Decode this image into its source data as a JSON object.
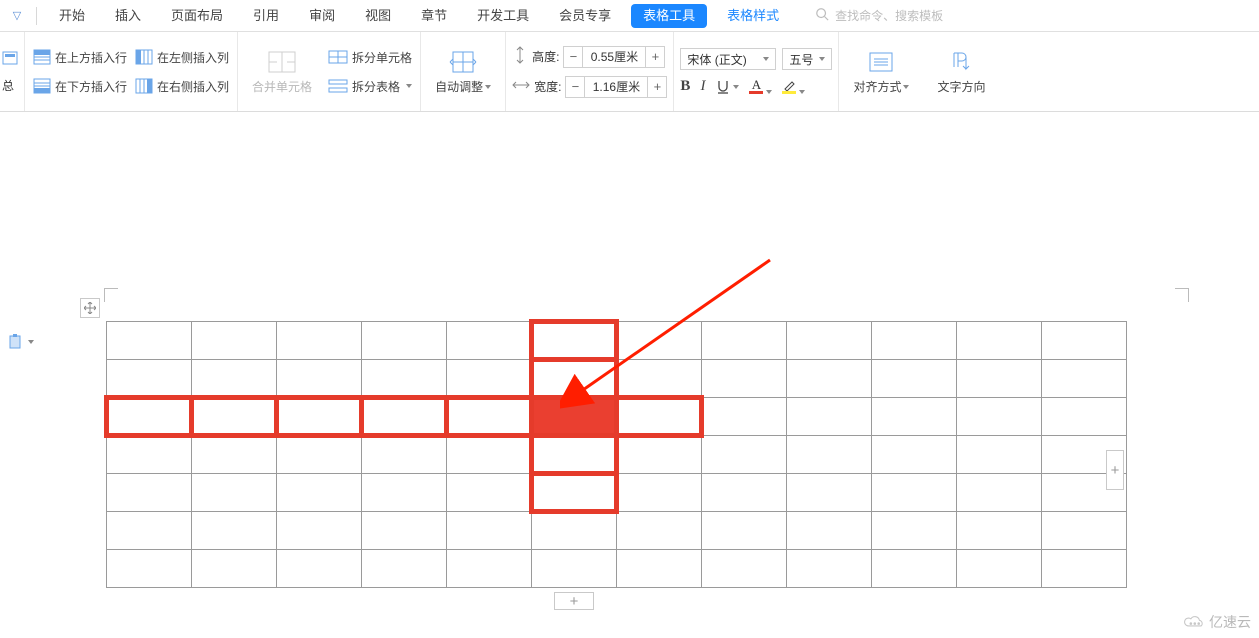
{
  "menu": {
    "items": [
      "开始",
      "插入",
      "页面布局",
      "引用",
      "审阅",
      "视图",
      "章节",
      "开发工具",
      "会员专享"
    ],
    "active": "表格工具",
    "secondary": "表格样式",
    "search_placeholder": "查找命令、搜索模板"
  },
  "ribbon": {
    "left_partial_top": "总",
    "insert_rows": {
      "above": "在上方插入行",
      "below": "在下方插入行",
      "left": "在左侧插入列",
      "right": "在右侧插入列"
    },
    "merge": "合并单元格",
    "split_cell": "拆分单元格",
    "split_table": "拆分表格",
    "auto_fit": "自动调整",
    "height_label": "高度:",
    "width_label": "宽度:",
    "height_value": "0.55厘米",
    "width_value": "1.16厘米",
    "font_name": "宋体 (正文)",
    "font_size": "五号",
    "align": "对齐方式",
    "text_dir": "文字方向"
  },
  "table": {
    "rows": 7,
    "cols": 12
  },
  "highlight": {
    "row_index": 2,
    "col_index": 5,
    "row_span_cols": [
      0,
      5
    ],
    "extra_col_right": 6
  },
  "colors": {
    "accent": "#1b87ff",
    "highlight": "#e53b2b",
    "text": "#444",
    "muted": "#b8b8b8"
  },
  "watermark": "亿速云"
}
